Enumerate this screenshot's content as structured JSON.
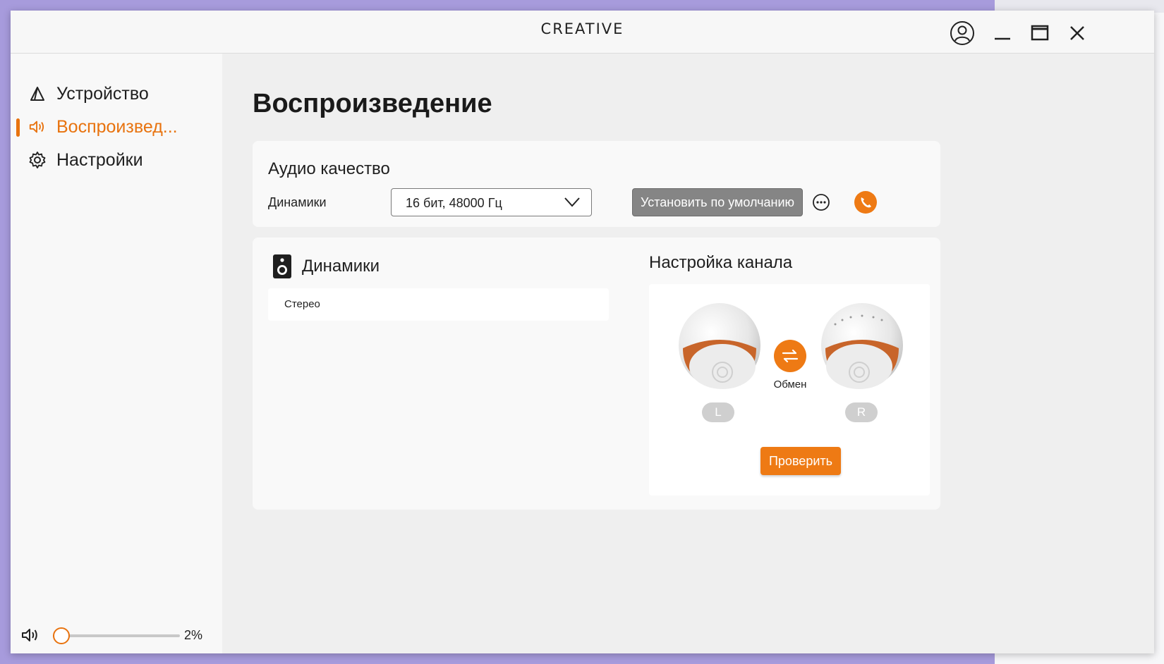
{
  "app": {
    "brand": "CREATIVE"
  },
  "sidebar": {
    "items": [
      {
        "label": "Устройство",
        "icon": "device-icon",
        "active": false
      },
      {
        "label": "Воспроизвед...",
        "icon": "speaker-volume-icon",
        "active": true
      },
      {
        "label": "Настройки",
        "icon": "gear-icon",
        "active": false
      }
    ],
    "volume": {
      "value": 2,
      "label": "2%"
    }
  },
  "main": {
    "title": "Воспроизведение",
    "audio_quality": {
      "title": "Аудио качество",
      "device_label": "Динамики",
      "format_value": "16 бит, 48000 Гц",
      "set_default_label": "Установить по умолчанию"
    },
    "speakers": {
      "title": "Динамики",
      "configs": [
        "Стерео"
      ]
    },
    "channel": {
      "title": "Настройка канала",
      "left_label": "L",
      "right_label": "R",
      "swap_label": "Обмен",
      "test_label": "Проверить"
    }
  },
  "colors": {
    "accent": "#ee7a14",
    "active_text": "#e8730f",
    "default_button": "#858585"
  }
}
